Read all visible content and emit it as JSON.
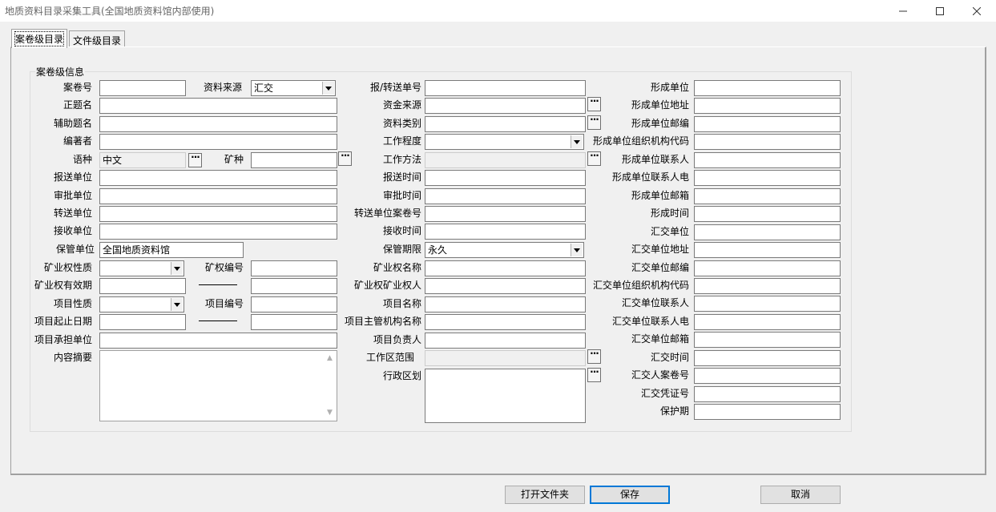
{
  "window": {
    "title": "地质资料目录采集工具(全国地质资料馆内部使用)"
  },
  "tabs": [
    {
      "label": "案卷级目录",
      "active": true
    },
    {
      "label": "文件级目录",
      "active": false
    }
  ],
  "group": {
    "legend": "案卷级信息"
  },
  "col1": {
    "case_no": {
      "label": "案卷号",
      "value": ""
    },
    "source": {
      "label": "资料来源",
      "value": "汇交"
    },
    "title": {
      "label": "正题名",
      "value": ""
    },
    "subtitle": {
      "label": "辅助题名",
      "value": ""
    },
    "author": {
      "label": "编著者",
      "value": ""
    },
    "language": {
      "label": "语种",
      "value": "中文"
    },
    "mineral": {
      "label": "矿种",
      "value": ""
    },
    "submit_unit": {
      "label": "报送单位",
      "value": ""
    },
    "approve_unit": {
      "label": "审批单位",
      "value": ""
    },
    "transfer_unit": {
      "label": "转送单位",
      "value": ""
    },
    "receive_unit": {
      "label": "接收单位",
      "value": ""
    },
    "custody_unit": {
      "label": "保管单位",
      "value": "全国地质资料馆"
    },
    "mining_right_nature": {
      "label": "矿业权性质",
      "value": ""
    },
    "mining_right_no": {
      "label": "矿权编号",
      "value": ""
    },
    "mining_right_validity": {
      "label": "矿业权有效期",
      "value": ""
    },
    "mining_right_validity_end": {
      "value": ""
    },
    "project_nature": {
      "label": "项目性质",
      "value": ""
    },
    "project_no": {
      "label": "项目编号",
      "value": ""
    },
    "project_period": {
      "label": "项目起止日期",
      "value": ""
    },
    "project_period_end": {
      "value": ""
    },
    "project_undertaker": {
      "label": "项目承担单位",
      "value": ""
    },
    "abstract": {
      "label": "内容摘要",
      "value": ""
    }
  },
  "col2": {
    "report_no": {
      "label": "报/转送单号",
      "value": ""
    },
    "fund_source": {
      "label": "资金来源",
      "value": ""
    },
    "data_category": {
      "label": "资料类别",
      "value": ""
    },
    "work_degree": {
      "label": "工作程度",
      "value": ""
    },
    "work_method": {
      "label": "工作方法",
      "value": ""
    },
    "submit_time": {
      "label": "报送时间",
      "value": ""
    },
    "approve_time": {
      "label": "审批时间",
      "value": ""
    },
    "transfer_case_no": {
      "label": "转送单位案卷号",
      "value": ""
    },
    "receive_time": {
      "label": "接收时间",
      "value": ""
    },
    "retention_period": {
      "label": "保管期限",
      "value": "永久"
    },
    "mining_right_name": {
      "label": "矿业权名称",
      "value": ""
    },
    "mining_right_holder": {
      "label": "矿业权矿业权人",
      "value": ""
    },
    "project_name": {
      "label": "项目名称",
      "value": ""
    },
    "project_authority": {
      "label": "项目主管机构名称",
      "value": ""
    },
    "project_leader": {
      "label": "项目负责人",
      "value": ""
    },
    "work_area": {
      "label": "工作区范围",
      "value": ""
    },
    "admin_region": {
      "label": "行政区划",
      "value": ""
    }
  },
  "col3": [
    {
      "label": "形成单位",
      "value": ""
    },
    {
      "label": "形成单位地址",
      "value": ""
    },
    {
      "label": "形成单位邮编",
      "value": ""
    },
    {
      "label": "形成单位组织机构代码",
      "value": ""
    },
    {
      "label": "形成单位联系人",
      "value": ""
    },
    {
      "label": "形成单位联系人电",
      "value": ""
    },
    {
      "label": "形成单位邮箱",
      "value": ""
    },
    {
      "label": "形成时间",
      "value": ""
    },
    {
      "label": "汇交单位",
      "value": ""
    },
    {
      "label": "汇交单位地址",
      "value": ""
    },
    {
      "label": "汇交单位邮编",
      "value": ""
    },
    {
      "label": "汇交单位组织机构代码",
      "value": ""
    },
    {
      "label": "汇交单位联系人",
      "value": ""
    },
    {
      "label": "汇交单位联系人电",
      "value": ""
    },
    {
      "label": "汇交单位邮箱",
      "value": ""
    },
    {
      "label": "汇交时间",
      "value": ""
    },
    {
      "label": "汇交人案卷号",
      "value": ""
    },
    {
      "label": "汇交凭证号",
      "value": ""
    },
    {
      "label": "保护期",
      "value": ""
    }
  ],
  "buttons": {
    "open_folder": "打开文件夹",
    "save": "保存",
    "cancel": "取消",
    "ellipsis": "···"
  },
  "icons": [
    "minimize-icon",
    "maximize-icon",
    "close-icon",
    "dropdown-arrow-icon",
    "ellipsis-icon"
  ]
}
